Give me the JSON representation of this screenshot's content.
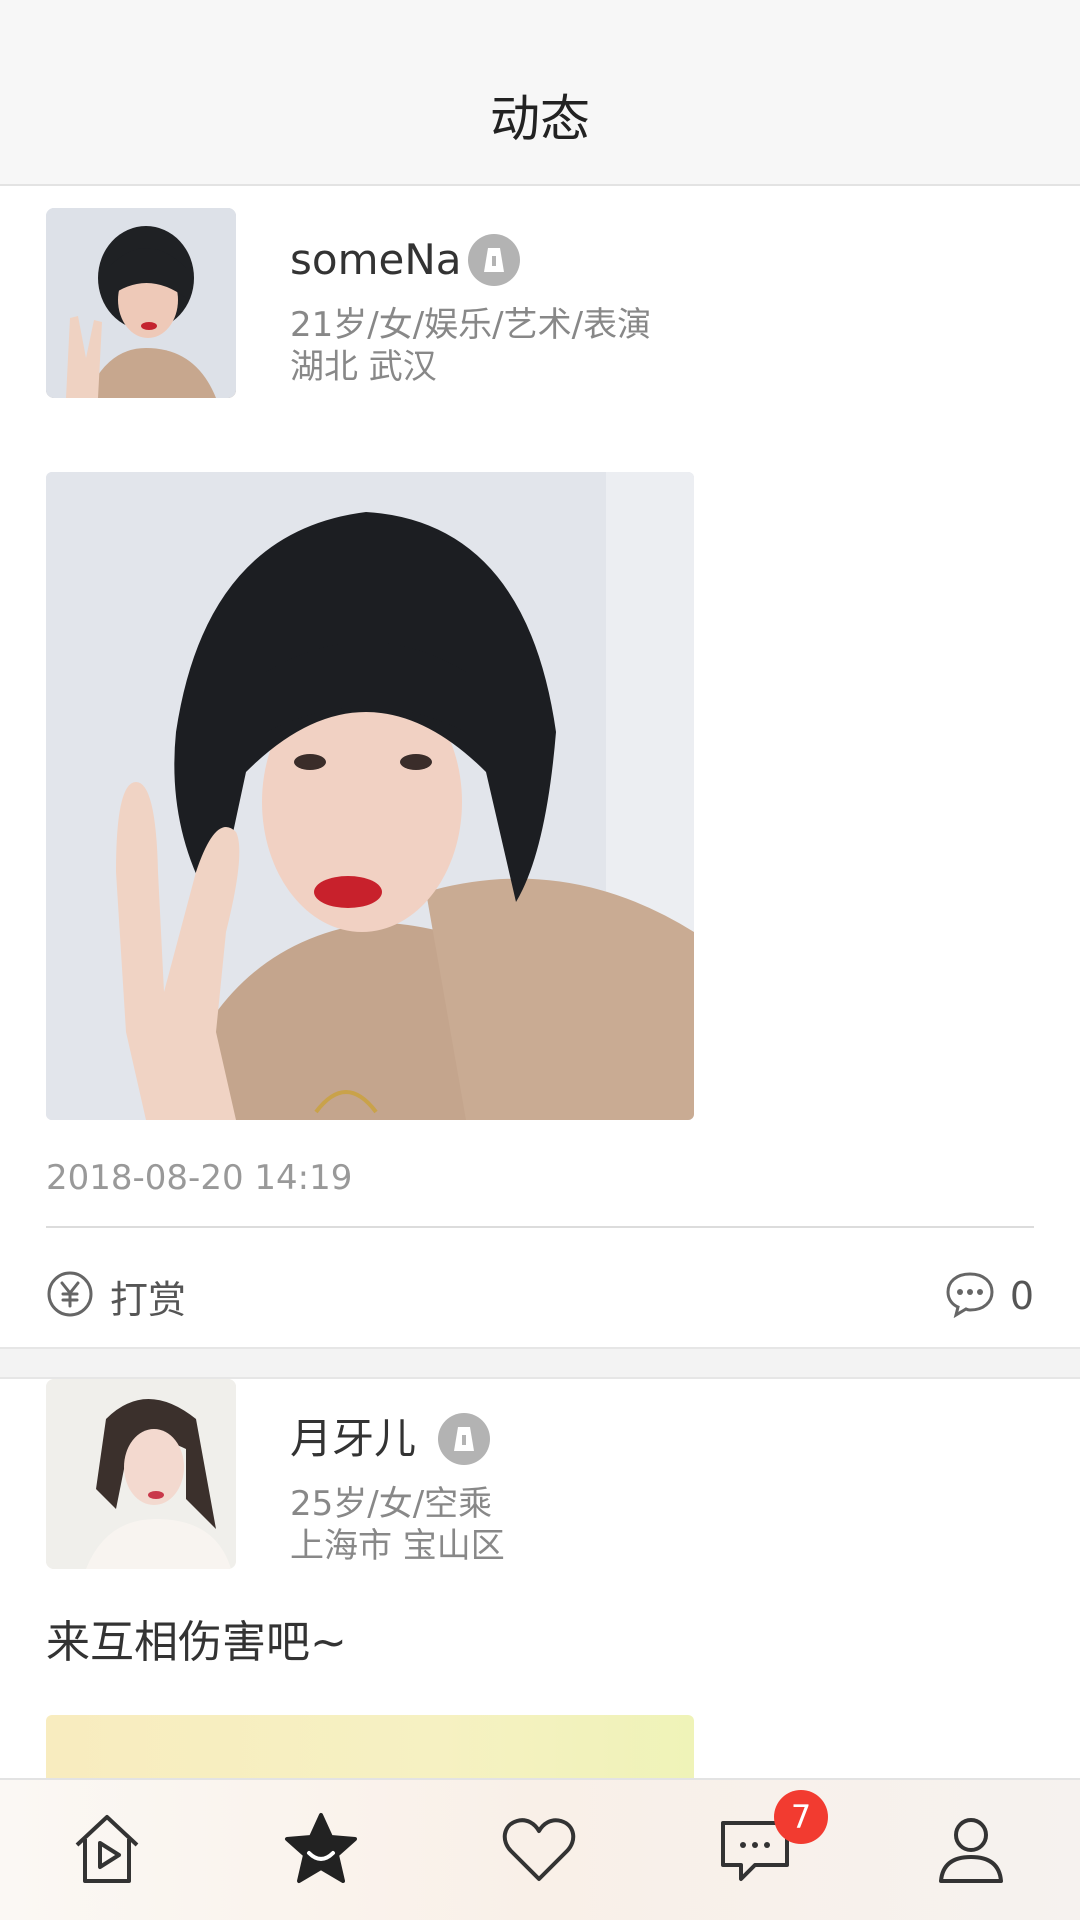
{
  "header": {
    "title": "动态"
  },
  "posts": [
    {
      "username": "someNa",
      "details": "21岁/女/娱乐/艺术/表演",
      "location": "湖北 武汉",
      "timestamp": "2018-08-20 14:19",
      "tip_label": "打赏",
      "comment_count": "0"
    },
    {
      "username": "月牙儿",
      "details": "25岁/女/空乘",
      "location": "上海市 宝山区",
      "caption": "来互相伤害吧~"
    }
  ],
  "tabbar": {
    "tabs": [
      {
        "icon": "home-play-icon"
      },
      {
        "icon": "star-icon",
        "active": true
      },
      {
        "icon": "heart-icon"
      },
      {
        "icon": "message-icon",
        "badge": "7"
      },
      {
        "icon": "profile-icon"
      }
    ]
  },
  "colors": {
    "badge_red": "#f23b30",
    "verified_gray": "#b3b3b3"
  }
}
